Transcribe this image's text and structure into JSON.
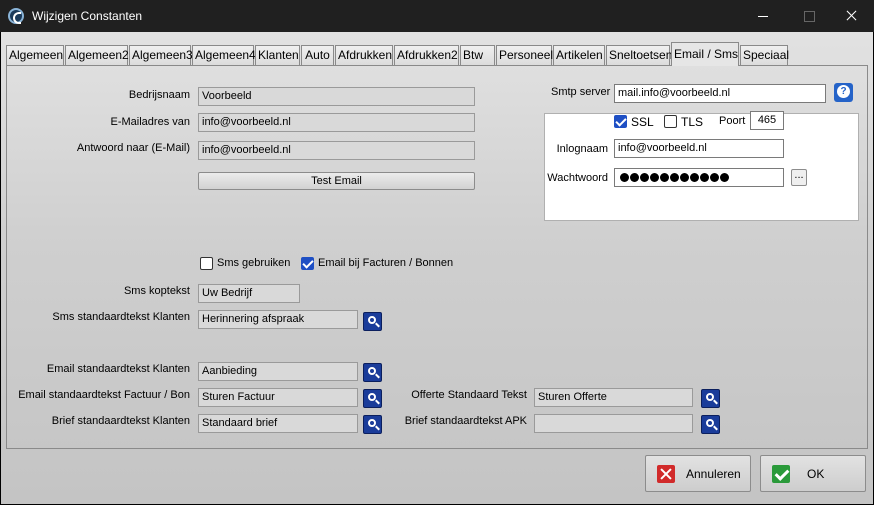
{
  "window": {
    "title": "Wijzigen Constanten"
  },
  "tabs": [
    {
      "label": "Algemeen"
    },
    {
      "label": "Algemeen2"
    },
    {
      "label": "Algemeen3"
    },
    {
      "label": "Algemeen4"
    },
    {
      "label": "Klanten"
    },
    {
      "label": "Auto"
    },
    {
      "label": "Afdrukken"
    },
    {
      "label": "Afdrukken2"
    },
    {
      "label": "Btw"
    },
    {
      "label": "Personeel"
    },
    {
      "label": "Artikelen"
    },
    {
      "label": "Sneltoetsen"
    },
    {
      "label": "Email / Sms",
      "active": true
    },
    {
      "label": "Speciaal"
    }
  ],
  "email": {
    "bedrijfsnaam_label": "Bedrijsnaam",
    "bedrijfsnaam_value": "Voorbeeld",
    "emailadres_label": "E-Mailadres van",
    "emailadres_value": "info@voorbeeld.nl",
    "antwoord_label": "Antwoord naar (E-Mail)",
    "antwoord_value": "info@voorbeeld.nl",
    "test_button": "Test Email"
  },
  "smtp": {
    "server_label": "Smtp server",
    "server_value": "mail.info@voorbeeld.nl",
    "ssl_label": "SSL",
    "ssl_checked": true,
    "tls_label": "TLS",
    "tls_checked": false,
    "poort_label": "Poort",
    "poort_value": "465",
    "inlognaam_label": "Inlognaam",
    "inlognaam_value": "info@voorbeeld.nl",
    "wachtwoord_label": "Wachtwoord",
    "wachtwoord_dots": 11,
    "dots_button": "..."
  },
  "options": {
    "sms_gebruiken_label": "Sms gebruiken",
    "sms_gebruiken_checked": false,
    "email_facturen_label": "Email bij Facturen / Bonnen",
    "email_facturen_checked": true
  },
  "sms": {
    "koptekst_label": "Sms koptekst",
    "koptekst_value": "Uw Bedrijf",
    "standaard_label": "Sms standaardtekst Klanten",
    "standaard_value": "Herinnering afspraak"
  },
  "templates": {
    "email_klanten_label": "Email standaardtekst Klanten",
    "email_klanten_value": "Aanbieding",
    "email_factuur_label": "Email standaardtekst Factuur / Bon",
    "email_factuur_value": "Sturen Factuur",
    "brief_klanten_label": "Brief standaardtekst Klanten",
    "brief_klanten_value": "Standaard brief",
    "offerte_label": "Offerte Standaard Tekst",
    "offerte_value": "Sturen Offerte",
    "brief_apk_label": "Brief standaardtekst APK",
    "brief_apk_value": ""
  },
  "buttons": {
    "annuleren": "Annuleren",
    "ok": "OK"
  }
}
